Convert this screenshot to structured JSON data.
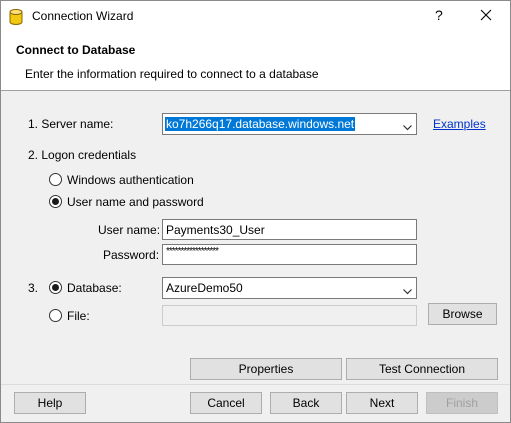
{
  "window": {
    "title": "Connection Wizard",
    "help_glyph": "?",
    "icons": {
      "app": "database-icon",
      "close": "close-icon"
    }
  },
  "header": {
    "title": "Connect to Database",
    "subtitle": "Enter the information required to connect to a database"
  },
  "server": {
    "label": "1. Server name:",
    "value": "ko7h266q17.database.windows.net",
    "examples_link": "Examples"
  },
  "logon": {
    "label": "2. Logon credentials",
    "windows_auth": "Windows authentication",
    "user_pass": "User name and password",
    "selected": "user_pass",
    "username_label": "User name:",
    "username_value": "Payments30_User",
    "password_label": "Password:",
    "password_value": "******************"
  },
  "database": {
    "step": "3.",
    "database_label": "Database:",
    "database_value": "AzureDemo50",
    "file_label": "File:",
    "file_value": "",
    "browse_button": "Browse",
    "selected": "database"
  },
  "actions": {
    "properties": "Properties",
    "test_connection": "Test Connection"
  },
  "footer": {
    "help": "Help",
    "cancel": "Cancel",
    "back": "Back",
    "next": "Next",
    "finish": "Finish"
  }
}
